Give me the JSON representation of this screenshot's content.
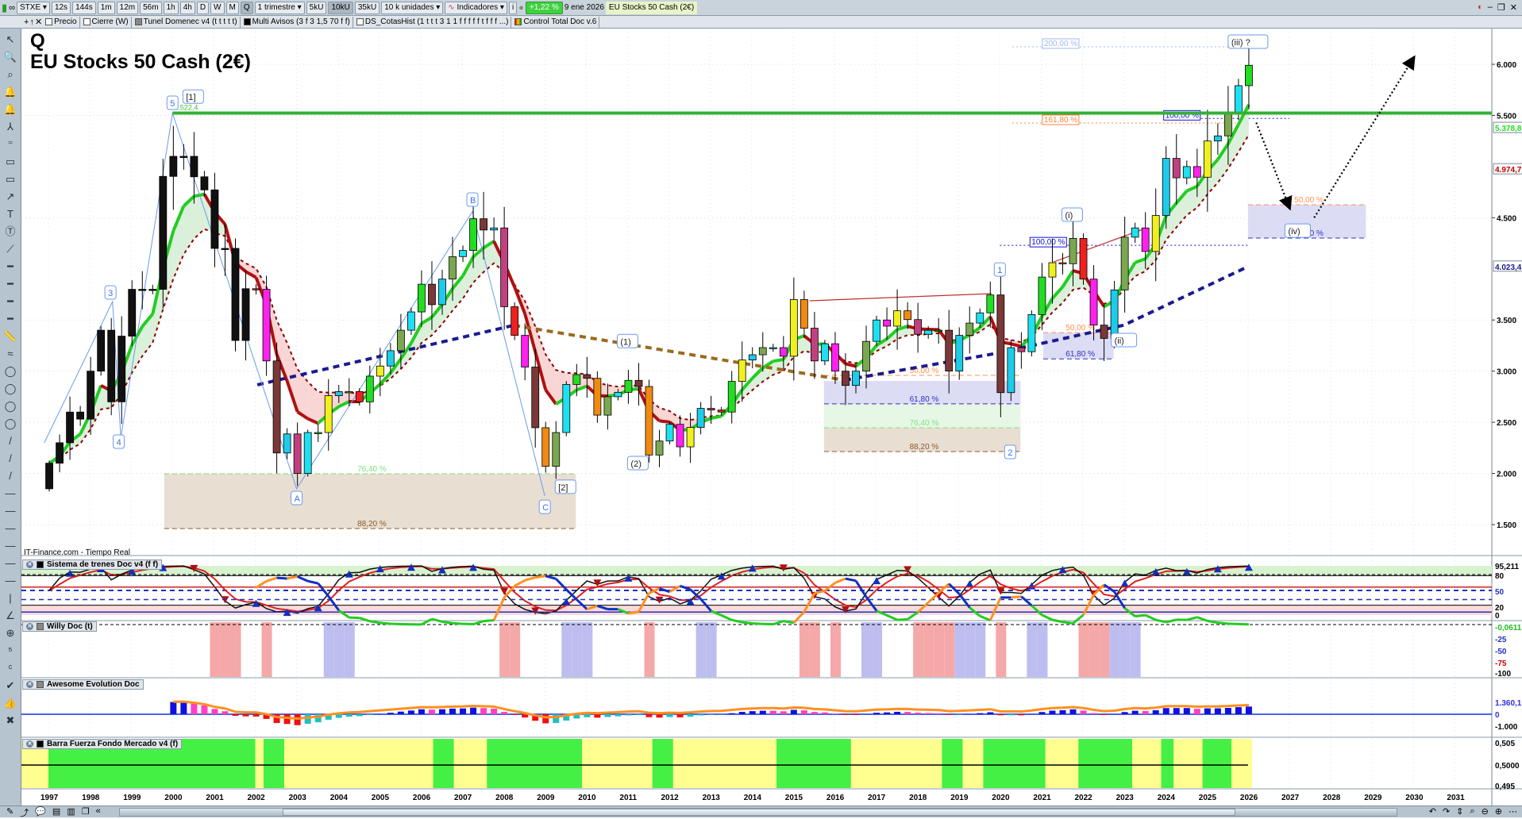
{
  "toolbar": {
    "symbol": "STXE",
    "timeframes": [
      "12s",
      "144s",
      "1m",
      "12m",
      "56m",
      "1h",
      "4h",
      "D",
      "W",
      "M",
      "Q"
    ],
    "active_timeframe": "Q",
    "period": "1 trimestre",
    "units": [
      "5kU",
      "10kU",
      "35kU"
    ],
    "active_unit": "10kU",
    "units_select": "10 k unidades",
    "indicators": "Indicadores",
    "info": "i",
    "change": "+1,22 %",
    "date": "9 ene 2026",
    "instrument": "EU Stocks 50 Cash (2€)"
  },
  "studies": [
    "Precio",
    "Cierre (W)",
    "Tunel Domenec v4 (t t t t t)",
    "Multi Avisos (3 f 3 1,5 70 f f)",
    "DS_CotasHist (1 t t t 3 1 1 f f f f f t f f f ...)",
    "Control Total Doc v.6"
  ],
  "chart": {
    "symbol_letter": "Q",
    "name": "EU Stocks 50 Cash (2€)",
    "source": "IT-Finance.com - Tiempo Real"
  },
  "colors": {
    "up": "#1ee0f0",
    "down": "#d2252a",
    "resistance": "#35b035",
    "ema_fast": "#22cc22",
    "ema_slow": "#8b0000",
    "long_ma": "#1a1a90",
    "trend_brown": "#9b6a1e"
  },
  "chart_data": {
    "type": "candlestick",
    "interval": "quarter",
    "start_year": 1997,
    "first_open": 1850,
    "closes": [
      2100,
      2300,
      2600,
      2531,
      3000,
      3400,
      2700,
      3342,
      3800,
      3800,
      3800,
      4904,
      5100,
      5100,
      4900,
      4772,
      4200,
      4200,
      3300,
      3806,
      3800,
      3100,
      2200,
      2386,
      2000,
      2400,
      2400,
      2760,
      2800,
      2800,
      2700,
      2951,
      3050,
      3200,
      3400,
      3579,
      3850,
      3650,
      3900,
      4120,
      4180,
      4490,
      4380,
      4400,
      3630,
      3350,
      3040,
      2447,
      2070,
      2400,
      2870,
      2966,
      2930,
      2570,
      2750,
      2793,
      2910,
      2850,
      2180,
      2317,
      2480,
      2260,
      2450,
      2636,
      2620,
      2600,
      2900,
      3109,
      3160,
      3230,
      3230,
      3146,
      3700,
      3420,
      3100,
      3268,
      3000,
      2860,
      3000,
      3291,
      3500,
      3440,
      3590,
      3504,
      3360,
      3400,
      3400,
      3001,
      3350,
      3470,
      3570,
      3745,
      2790,
      3230,
      3190,
      3553,
      3920,
      4060,
      4050,
      4298,
      3900,
      3450,
      3320,
      3794,
      4310,
      4400,
      4170,
      4522,
      5080,
      4890,
      5000,
      4896,
      5250,
      5300,
      5530,
      5791,
      5990
    ],
    "ylim": [
      1200,
      6300
    ],
    "xlim": [
      1997,
      2031.7
    ],
    "y_ticks": [
      "6.000",
      "5.500",
      "4.500",
      "3.500",
      "3.000",
      "2.500",
      "2.000",
      "1.500"
    ],
    "y_tick_values": [
      6000,
      5500,
      4500,
      3500,
      3000,
      2500,
      2000,
      1500
    ],
    "x_ticks": [
      "1997",
      "1998",
      "1999",
      "2000",
      "2001",
      "2002",
      "2003",
      "2004",
      "2005",
      "2006",
      "2007",
      "2008",
      "2009",
      "2010",
      "2011",
      "2012",
      "2013",
      "2014",
      "2015",
      "2016",
      "2017",
      "2018",
      "2019",
      "2020",
      "2021",
      "2022",
      "2023",
      "2024",
      "2025",
      "2026",
      "2027",
      "2028",
      "2029",
      "2030",
      "2031"
    ],
    "price_tags": [
      {
        "text": "5.378,8",
        "value": 5378.8,
        "color": "#22dd22"
      },
      {
        "text": "4.974,7",
        "value": 4974.7,
        "color": "#c00000"
      },
      {
        "text": "4.023,4",
        "value": 4023.4,
        "color": "#1a1a90"
      }
    ],
    "resistance": {
      "value": 5522.4,
      "label": "5.522,4",
      "from": 2000.0
    },
    "long_ma_early": [
      [
        2002.05,
        2866
      ],
      [
        2008.25,
        3448
      ]
    ],
    "trend_brown": [
      [
        2008.25,
        3448
      ],
      [
        2016.25,
        2912
      ]
    ],
    "long_ma_late": [
      [
        2016.25,
        2912
      ],
      [
        2020,
        3180
      ],
      [
        2023,
        3450
      ],
      [
        2026.0,
        4022
      ]
    ],
    "trendlines": [
      [
        [
          2015.4,
          3688
        ],
        [
          2019.8,
          3758
        ]
      ],
      [
        [
          2021.3,
          4068
        ],
        [
          2023.5,
          4393
        ]
      ]
    ],
    "waves": [
      {
        "text": "5",
        "x": 2000.0,
        "y": 5620
      },
      {
        "text": "[1]",
        "x": 2000.5,
        "y": 5680
      },
      {
        "text": "3",
        "x": 1998.5,
        "y": 3766
      },
      {
        "text": "4",
        "x": 1998.7,
        "y": 2307
      },
      {
        "text": "A",
        "x": 2003.0,
        "y": 1756
      },
      {
        "text": "B",
        "x": 2007.25,
        "y": 4673
      },
      {
        "text": "C",
        "x": 2009.0,
        "y": 1670
      },
      {
        "text": "[2]",
        "x": 2009.5,
        "y": 1866
      },
      {
        "text": "(1)",
        "x": 2011.0,
        "y": 3290
      },
      {
        "text": "(2)",
        "x": 2011.25,
        "y": 2097
      },
      {
        "text": "1",
        "x": 2020.0,
        "y": 3990
      },
      {
        "text": "2",
        "x": 2020.25,
        "y": 2206
      },
      {
        "text": "(i)",
        "x": 2021.75,
        "y": 4526
      },
      {
        "text": "(ii)",
        "x": 2023.0,
        "y": 3300
      },
      {
        "text": "(iii) ?",
        "x": 2026.0,
        "y": 6217
      },
      {
        "text": "(iv)",
        "x": 2027.2,
        "y": 4370
      }
    ],
    "zigzag": [
      [
        1996.9,
        2300
      ],
      [
        1998.55,
        3680
      ],
      [
        1998.75,
        2350
      ],
      [
        2000.0,
        5522
      ],
      [
        2003.0,
        1850
      ],
      [
        2007.25,
        4560
      ],
      [
        2009.0,
        1780
      ]
    ],
    "fib_zones": [
      {
        "x0": 1999.8,
        "x1": 2009.75,
        "bands": [
          {
            "from": 1997,
            "to": 1461,
            "fill": "#e9ded2"
          }
        ],
        "levels": [
          {
            "text": "76,40 %",
            "value": 1997,
            "color": "#7fe07f"
          },
          {
            "text": "88,20 %",
            "value": 1461,
            "color": "#8a5a2a"
          }
        ]
      },
      {
        "x0": 2015.75,
        "x1": 2020.5,
        "bands": [
          {
            "from": 2904,
            "to": 2680,
            "fill": "#dcdcf5"
          },
          {
            "from": 2680,
            "to": 2447,
            "fill": "#e6f7e6"
          },
          {
            "from": 2447,
            "to": 2214,
            "fill": "#e9ded2"
          }
        ],
        "levels": [
          {
            "text": "50,00 %",
            "value": 2959,
            "color": "#ff9050"
          },
          {
            "text": "61,80 %",
            "value": 2680,
            "color": "#3030c0"
          },
          {
            "text": "76,40 %",
            "value": 2447,
            "color": "#7fe07f"
          },
          {
            "text": "88,20 %",
            "value": 2214,
            "color": "#8a5a2a"
          }
        ]
      },
      {
        "x0": 2021.05,
        "x1": 2022.75,
        "bands": [
          {
            "from": 3377,
            "to": 3120,
            "fill": "#dcdcf5"
          }
        ],
        "levels": [
          {
            "text": "50,00 %",
            "value": 3377,
            "color": "#ff9050"
          },
          {
            "text": "61,80 %",
            "value": 3120,
            "color": "#3030c0"
          }
        ]
      },
      {
        "x0": 2026.0,
        "x1": 2028.85,
        "bands": [
          {
            "from": 4627,
            "to": 4301,
            "fill": "#dcdcf5"
          }
        ],
        "levels": [
          {
            "text": "50,00 %",
            "value": 4627,
            "color": "#ff9050"
          },
          {
            "text": "61,80 %",
            "value": 4301,
            "color": "#3030c0"
          }
        ]
      }
    ],
    "fib_ext": [
      {
        "text": "200,00 %",
        "value": 6171,
        "x0": 2020.3,
        "x1": 2026.0,
        "color": "#a0b8f0",
        "boxed": true
      },
      {
        "text": "161,80 %",
        "value": 5426,
        "x0": 2020.3,
        "x1": 2026.0,
        "color": "#ff8040",
        "boxed": true
      },
      {
        "text": "100,00 %",
        "value": 5470,
        "x0": 2024.0,
        "x1": 2027.0,
        "color": "#1010d0",
        "boxed": true
      },
      {
        "text": "100,00 %",
        "value": 4230,
        "x0": 2020.0,
        "x1": 2026.0,
        "color": "#1010d0",
        "boxed": true
      }
    ],
    "projection": [
      [
        [
          2026.2,
          5430
        ],
        [
          2027.0,
          4600
        ]
      ],
      [
        [
          2027.6,
          4500
        ],
        [
          2030.0,
          6060
        ]
      ]
    ]
  },
  "panels": {
    "sistema": {
      "title": "Sistema de trenes Doc v4 (f f)",
      "ticks": [
        "95,211",
        "80",
        "50",
        "20",
        "0"
      ]
    },
    "willy": {
      "title": "Willy Doc (t)",
      "ticks": [
        "-0,0611",
        "-25",
        "-50",
        "-75",
        "-100"
      ]
    },
    "awesome": {
      "title": "Awesome Evolution Doc",
      "ticks": [
        "1.360,1",
        "0",
        "-1.000"
      ]
    },
    "barra": {
      "title": "Barra Fuerza Fondo Mercado v4 (f)",
      "ticks": [
        "0,505",
        "0,5000",
        "0,495"
      ],
      "green_ranges": [
        [
          1997,
          2002.0
        ],
        [
          2002.2,
          2002.7
        ],
        [
          2006.3,
          2006.8
        ],
        [
          2007.6,
          2009.9
        ],
        [
          2011.6,
          2012.1
        ],
        [
          2014.6,
          2016.4
        ],
        [
          2018.6,
          2019.1
        ],
        [
          2019.6,
          2021.1
        ],
        [
          2021.9,
          2023.2
        ],
        [
          2023.9,
          2024.2
        ],
        [
          2024.9,
          2025.6
        ]
      ],
      "end": 2026.1
    }
  }
}
